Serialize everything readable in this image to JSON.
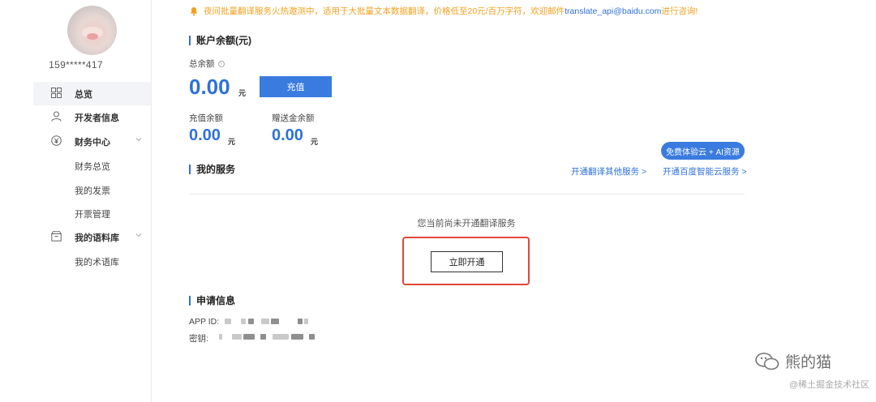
{
  "user": {
    "name": "159*****417"
  },
  "sidebar": {
    "items": [
      {
        "label": "总览",
        "icon": "grid-icon",
        "active": true
      },
      {
        "label": "开发者信息",
        "icon": "user-icon"
      },
      {
        "label": "财务中心",
        "icon": "yen-icon",
        "expandable": true
      },
      {
        "label": "我的语料库",
        "icon": "box-icon",
        "expandable": true
      }
    ],
    "finance_sub": [
      "财务总览",
      "我的发票",
      "开票管理"
    ],
    "corpus_sub": [
      "我的术语库"
    ]
  },
  "notice": {
    "text": "夜间批量翻译服务火热邀测中，适用于大批量文本数据翻译，价格低至20元/百万字符，欢迎邮件",
    "email": "translate_api@baidu.com",
    "tail": "进行咨询!"
  },
  "balance": {
    "section_title": "账户余额(元)",
    "total_label": "总余额",
    "total_value": "0.00",
    "unit": "元",
    "recharge_button": "充值",
    "recharge_label": "充值余额",
    "recharge_value": "0.00",
    "gift_label": "赠送金余额",
    "gift_value": "0.00"
  },
  "promo_button": "免费体验云 + AI资源",
  "services": {
    "section_title": "我的服务",
    "link_other": "开通翻译其他服务 >",
    "link_cloud": "开通百度智能云服务 >",
    "empty_text": "您当前尚未开通翻译服务",
    "open_button": "立即开通"
  },
  "apply": {
    "section_title": "申请信息",
    "app_id_label": "APP ID:",
    "secret_label": "密钥:"
  },
  "watermark": {
    "main": "熊的猫",
    "sub": "@稀土掘金技术社区"
  },
  "colors": {
    "accent": "#2e71d9",
    "button": "#3a7be0",
    "notice": "#f0a020",
    "highlight": "#e0473c"
  }
}
